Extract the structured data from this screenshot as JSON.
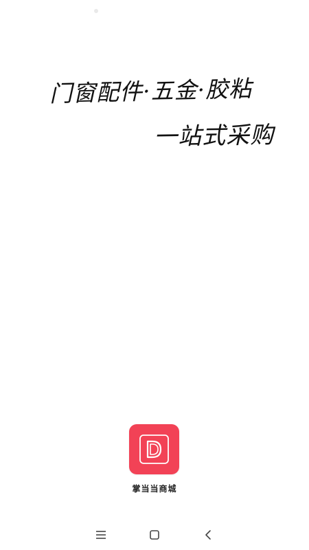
{
  "slogan": {
    "line1": "门窗配件·五金·胶粘",
    "line2": "一站式采购"
  },
  "app": {
    "name": "掌当当商城",
    "icon_letter": "D",
    "icon_color": "#f24256"
  },
  "nav": {
    "menu_icon": "menu-icon",
    "home_icon": "home-square-icon",
    "back_icon": "back-chevron-icon"
  }
}
